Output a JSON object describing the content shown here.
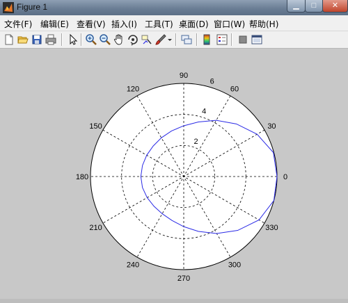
{
  "window": {
    "title": "Figure 1",
    "buttons": {
      "minimize": "▁",
      "maximize": "□",
      "close": "✕"
    }
  },
  "menu": [
    "文件(F)",
    "编辑(E)",
    "查看(V)",
    "插入(I)",
    "工具(T)",
    "桌面(D)",
    "窗口(W)",
    "帮助(H)"
  ],
  "toolbar": {
    "icons": [
      "new-figure-icon",
      "open-file-icon",
      "save-icon",
      "print-icon",
      "pointer-icon",
      "zoom-in-icon",
      "zoom-out-icon",
      "pan-hand-icon",
      "rotate-3d-icon",
      "data-cursor-icon",
      "brush-icon",
      "brush-dropdown-icon",
      "link-plot-icon",
      "colorbar-icon",
      "legend-icon",
      "hide-plot-tools-icon",
      "show-plot-tools-icon"
    ]
  },
  "colors": {
    "curve": "#2a2ae6",
    "background": "#c8c8c8",
    "plot_bg": "#ffffff"
  },
  "chart_data": {
    "type": "line",
    "coordinate_system": "polar",
    "angle_ticks_deg": [
      0,
      30,
      60,
      90,
      120,
      150,
      180,
      210,
      240,
      270,
      300,
      330
    ],
    "angle_labels": [
      "0",
      "30",
      "60",
      "90",
      "120",
      "150",
      "180",
      "210",
      "240",
      "270",
      "300",
      "330"
    ],
    "radial_ticks": [
      2,
      4,
      6
    ],
    "radial_labels": [
      "2",
      "4",
      "6"
    ],
    "radial_range": [
      0,
      6
    ],
    "radial_label_angle_deg": 75,
    "grid": true,
    "series": [
      {
        "shape": "ellipse",
        "theta_deg": [
          0,
          15,
          30,
          45,
          60,
          75,
          90,
          105,
          120,
          135,
          150,
          165,
          180,
          195,
          210,
          225,
          240,
          255,
          270,
          285,
          300,
          315,
          330,
          345,
          360
        ],
        "r": [
          6.0,
          5.97,
          5.45,
          4.79,
          4.18,
          3.64,
          3.27,
          3.04,
          2.88,
          2.78,
          2.75,
          2.75,
          2.76,
          2.75,
          2.72,
          2.71,
          2.77,
          2.93,
          3.23,
          3.66,
          4.24,
          4.91,
          5.59,
          6.0,
          6.0
        ]
      }
    ]
  }
}
